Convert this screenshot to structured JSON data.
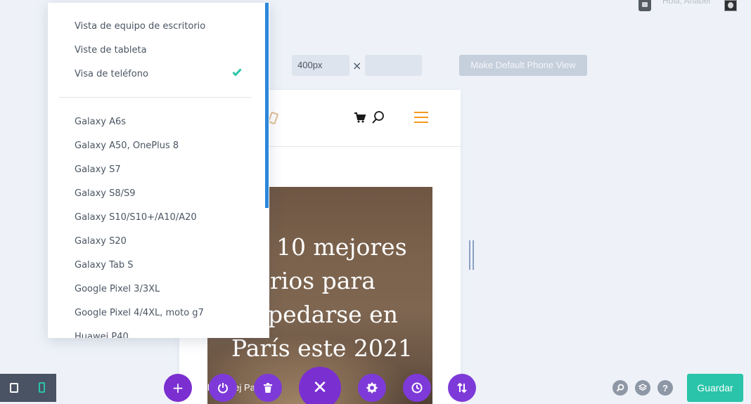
{
  "admin": {
    "greeting": "Hola, Anabel"
  },
  "size_controls": {
    "width_value": "400px",
    "times": "×",
    "height_value": "",
    "default_button": "Make Default Phone View"
  },
  "dropdown": {
    "views": [
      {
        "label": "Vista de equipo de escritorio",
        "selected": false
      },
      {
        "label": "Viste de tableta",
        "selected": false
      },
      {
        "label": "Visa de teléfono",
        "selected": true
      }
    ],
    "devices": [
      "Galaxy A6s",
      "Galaxy A50, OnePlus 8",
      "Galaxy S7",
      "Galaxy S8/S9",
      "Galaxy S10/S10+/A10/A20",
      "Galaxy S20",
      "Galaxy Tab S",
      "Google Pixel 3/3XL",
      "Google Pixel 4/4XL, moto g7",
      "Huawei P40"
    ],
    "check_color": "#29c4a9",
    "scroll_color": "#2b87da"
  },
  "preview": {
    "hero_title": "10 mejores rios para pedarse en París este 2021",
    "hero_title_lines": [
      "10 mejores",
      "rios para",
      "pedarse en",
      "París este 2021"
    ],
    "hero_sub": "lanit  mej  Par"
  },
  "toolbar": {
    "add": "+",
    "close": "✕",
    "save": "Guardar",
    "help": "?"
  },
  "colors": {
    "accent": "#7b2fd0",
    "save": "#29c4a9",
    "menu": "#f29a1e"
  }
}
